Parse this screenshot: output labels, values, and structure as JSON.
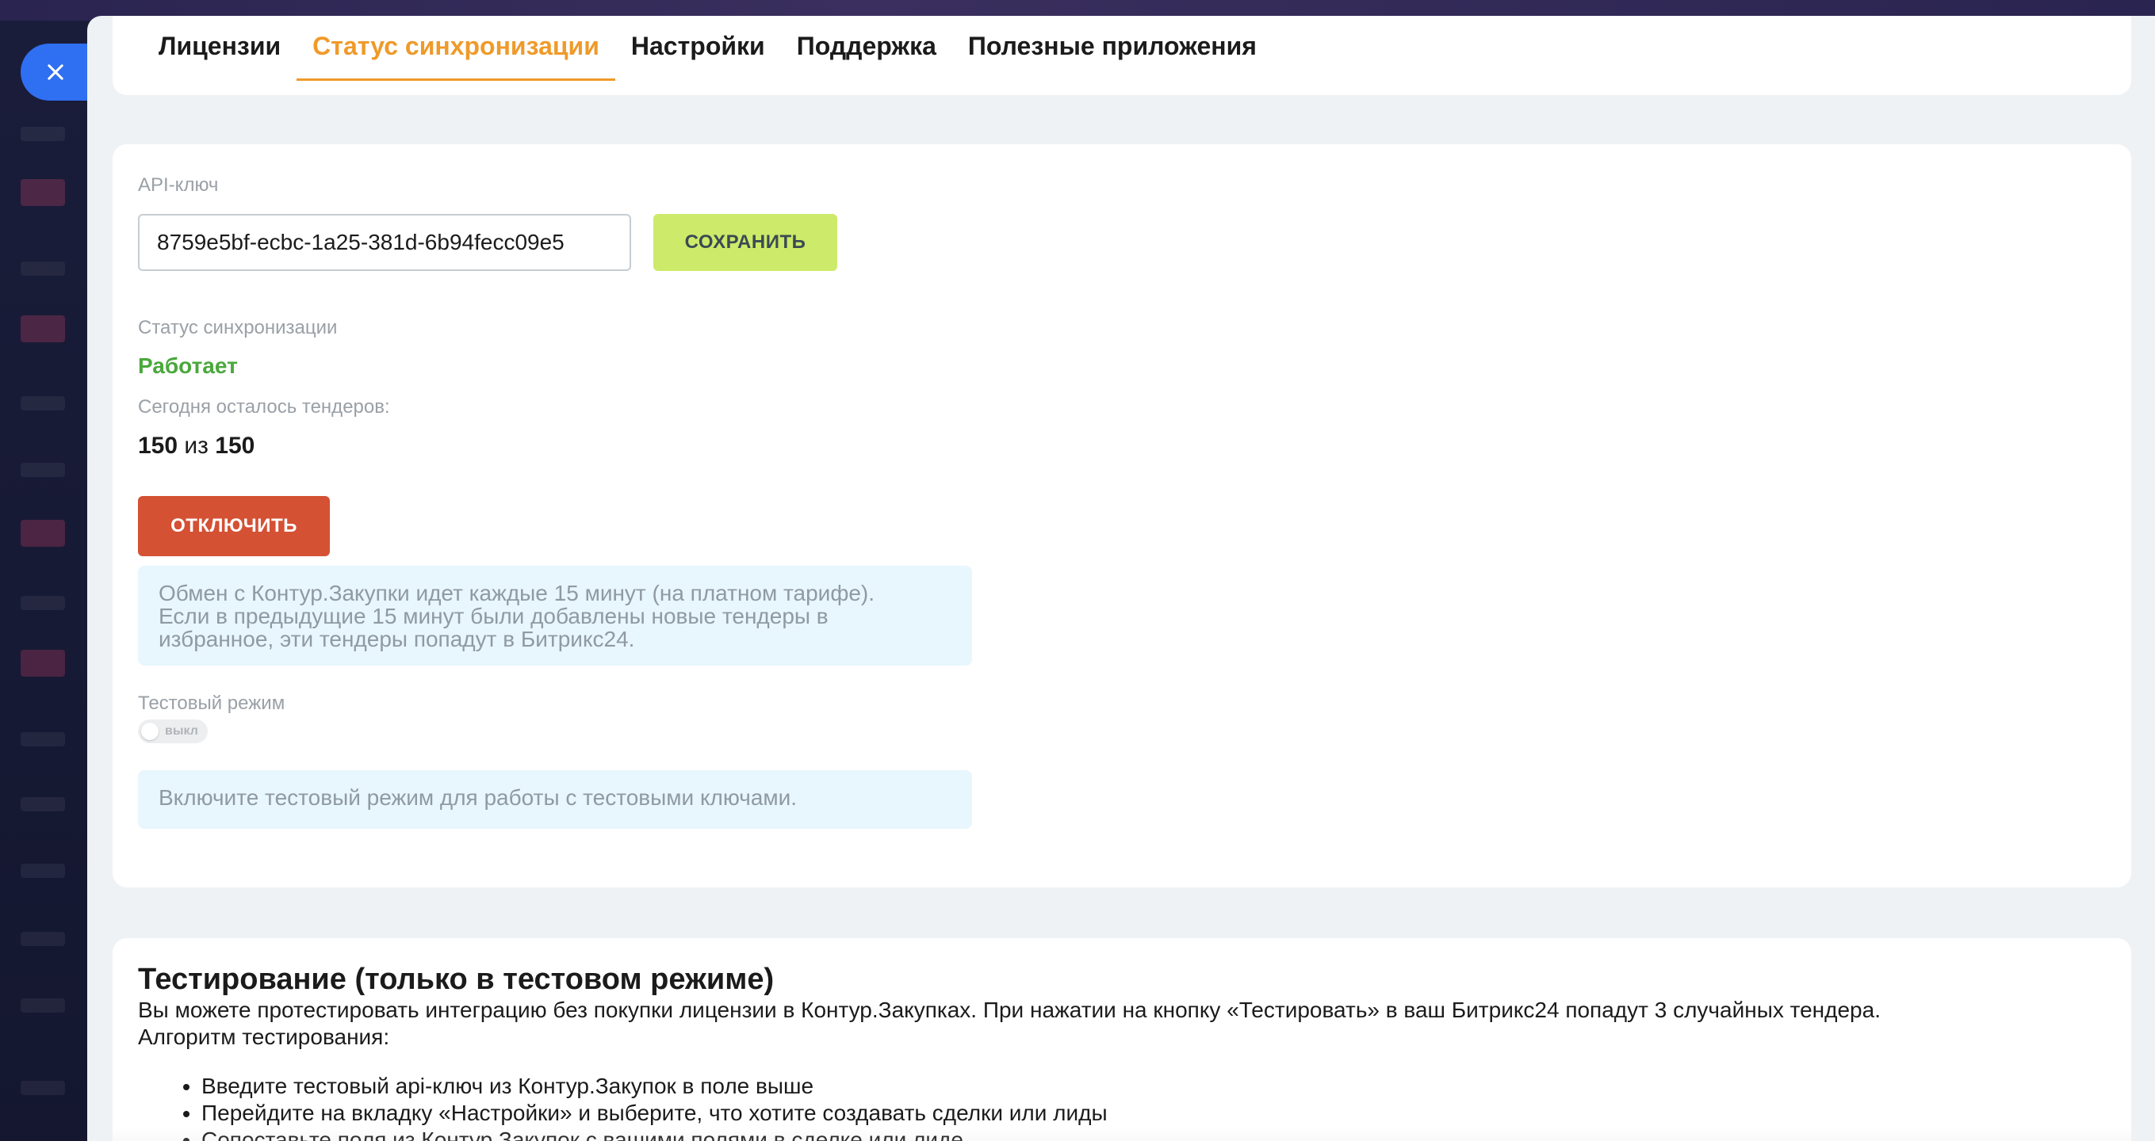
{
  "close_button": {
    "icon": "close-icon",
    "color": "#2f6ff2"
  },
  "tabs": [
    {
      "label": "Лицензии",
      "active": false
    },
    {
      "label": "Статус синхронизации",
      "active": true
    },
    {
      "label": "Настройки",
      "active": false
    },
    {
      "label": "Поддержка",
      "active": false
    },
    {
      "label": "Полезные приложения",
      "active": false
    }
  ],
  "api": {
    "label": "API-ключ",
    "value": "8759e5bf-ecbc-1a25-381d-6b94fecc09e5",
    "save_label": "СОХРАНИТЬ"
  },
  "sync_status": {
    "label": "Статус синхронизации",
    "value": "Работает"
  },
  "tenders": {
    "label": "Сегодня осталось тендеров:",
    "remaining": "150",
    "separator": "из",
    "total": "150"
  },
  "disable_label": "ОТКЛЮЧИТЬ",
  "exchange_info": [
    "Обмен с Контур.Закупки идет каждые 15 минут (на платном тарифе).",
    "Если в предыдущие 15 минут были добавлены новые тендеры в",
    "избранное, эти тендеры попадут в Битрикс24."
  ],
  "test_mode": {
    "label": "Тестовый режим",
    "toggle_label": "выкл",
    "enabled": false,
    "info": "Включите тестовый режим для работы с тестовыми ключами."
  },
  "testing": {
    "title": "Тестирование (только в тестовом режиме)",
    "description": "Вы можете протестировать интеграцию без покупки лицензии в Контур.Закупках. При нажатии на кнопку «Тестировать» в ваш Битрикс24 попадут 3 случайных тендера.",
    "algorithm_label": "Алгоритм тестирования:",
    "steps": [
      "Введите тестовый api-ключ из Контур.Закупок в поле выше",
      "Перейдите на вкладку «Настройки» и выберите, что хотите создавать сделки или лиды",
      "Сопоставьте поля из Контур.Закупок с вашими полями в сделке или лиде"
    ]
  },
  "colors": {
    "accent_tab": "#ef9a2a",
    "save_button": "#cdea6a",
    "disable_button": "#d45134",
    "status_ok": "#4aa83c",
    "info_bg": "#e8f6fd"
  }
}
